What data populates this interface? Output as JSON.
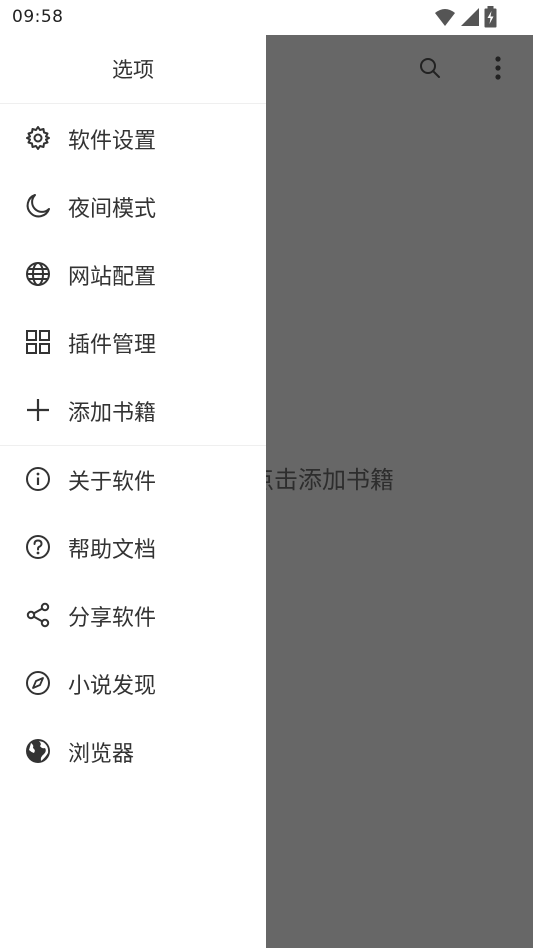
{
  "status_bar": {
    "time": "09:58"
  },
  "drawer": {
    "title": "选项",
    "items": [
      {
        "label": "软件设置",
        "icon": "gear-icon"
      },
      {
        "label": "夜间模式",
        "icon": "moon-icon"
      },
      {
        "label": "网站配置",
        "icon": "globe-icon"
      },
      {
        "label": "插件管理",
        "icon": "grid-icon"
      },
      {
        "label": "添加书籍",
        "icon": "plus-icon"
      },
      {
        "label": "关于软件",
        "icon": "info-icon"
      },
      {
        "label": "帮助文档",
        "icon": "help-icon"
      },
      {
        "label": "分享软件",
        "icon": "share-icon"
      },
      {
        "label": "小说发现",
        "icon": "compass-icon"
      },
      {
        "label": "浏览器",
        "icon": "earth-icon"
      }
    ]
  },
  "main": {
    "empty_hint": "点击添加书籍"
  },
  "colors": {
    "drawer_bg": "#ffffff",
    "scrim": "#676767",
    "text": "#333333"
  }
}
